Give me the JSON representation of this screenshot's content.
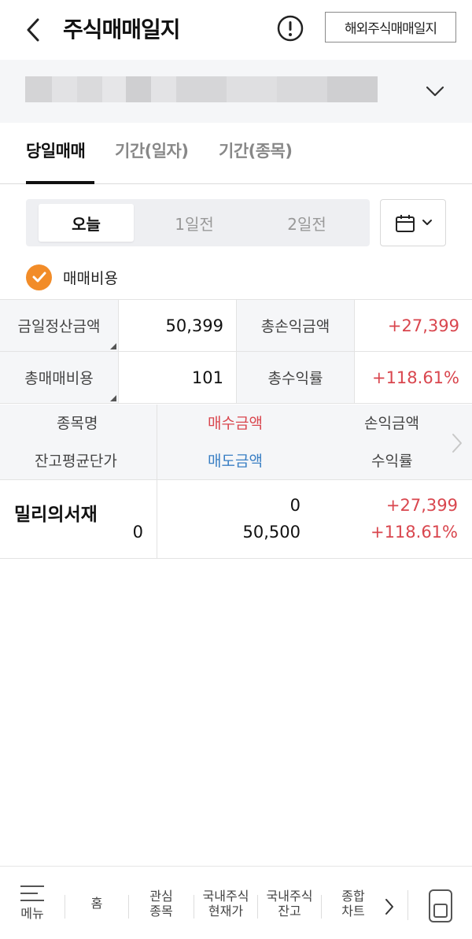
{
  "header": {
    "title": "주식매매일지",
    "overseas_button": "해외주식매매일지"
  },
  "account": {
    "masked": true
  },
  "tabs": [
    {
      "label": "당일매매",
      "active": true
    },
    {
      "label": "기간(일자)",
      "active": false
    },
    {
      "label": "기간(종목)",
      "active": false
    }
  ],
  "day_selector": {
    "options": [
      "오늘",
      "1일전",
      "2일전"
    ],
    "selected": "오늘"
  },
  "fee_toggle": {
    "label": "매매비용",
    "checked": true
  },
  "summary": {
    "settlement_label": "금일정산금액",
    "settlement_value": "50,399",
    "total_pnl_label": "총손익금액",
    "total_pnl_value": "+27,399",
    "total_fee_label": "총매매비용",
    "total_fee_value": "101",
    "total_return_label": "총수익률",
    "total_return_value": "+118.61%"
  },
  "list_header": {
    "name": "종목명",
    "avg_price": "잔고평균단가",
    "buy_amount": "매수금액",
    "sell_amount": "매도금액",
    "pnl_amount": "손익금액",
    "return_rate": "수익률"
  },
  "rows": [
    {
      "name": "밀리의서재",
      "avg_price": "0",
      "buy_amount": "0",
      "sell_amount": "50,500",
      "pnl_amount": "+27,399",
      "return_rate": "+118.61%"
    }
  ],
  "bottom_nav": {
    "menu": "메뉴",
    "home": "홈",
    "watch_1": "관심",
    "watch_2": "종목",
    "price_1": "국내주식",
    "price_2": "현재가",
    "balance_1": "국내주식",
    "balance_2": "잔고",
    "chart_1": "종합",
    "chart_2": "차트"
  },
  "colors": {
    "accent_orange": "#f28c28",
    "positive_red": "#d9464e",
    "sell_blue": "#3a7fc4",
    "panel_gray": "#f5f6f8"
  }
}
